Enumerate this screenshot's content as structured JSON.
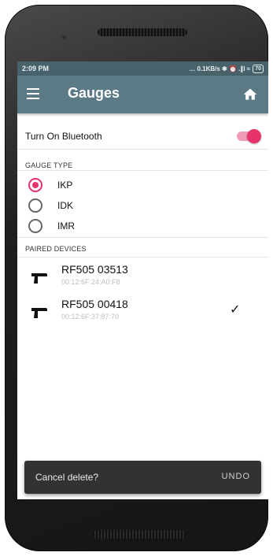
{
  "status_bar": {
    "time": "2:09 PM",
    "indicators": "… 0.1KB/s ✱ ⏰ .∥l ≈",
    "battery": "70"
  },
  "app_bar": {
    "title": "Gauges",
    "menu_icon": "hamburger-menu-icon",
    "home_icon": "home-icon"
  },
  "bluetooth": {
    "label": "Turn On Bluetooth",
    "enabled": true,
    "accent_color": "#e8336a"
  },
  "gauge_type": {
    "header": "GAUGE TYPE",
    "options": [
      {
        "label": "IKP",
        "selected": true
      },
      {
        "label": "IDK",
        "selected": false
      },
      {
        "label": "IMR",
        "selected": false
      }
    ]
  },
  "paired_devices": {
    "header": "PAIRED DEVICES",
    "items": [
      {
        "name": "RF505 03513",
        "mac": "00:12:6F:24:A0:F8",
        "checked": false
      },
      {
        "name": "RF505 00418",
        "mac": "00:12:6F:37:87:70",
        "checked": true
      }
    ]
  },
  "snackbar": {
    "message": "Cancel delete?",
    "action": "UNDO"
  },
  "colors": {
    "app_bar": "#5c7a85",
    "status_bar": "#48626c",
    "accent": "#e8336a"
  }
}
